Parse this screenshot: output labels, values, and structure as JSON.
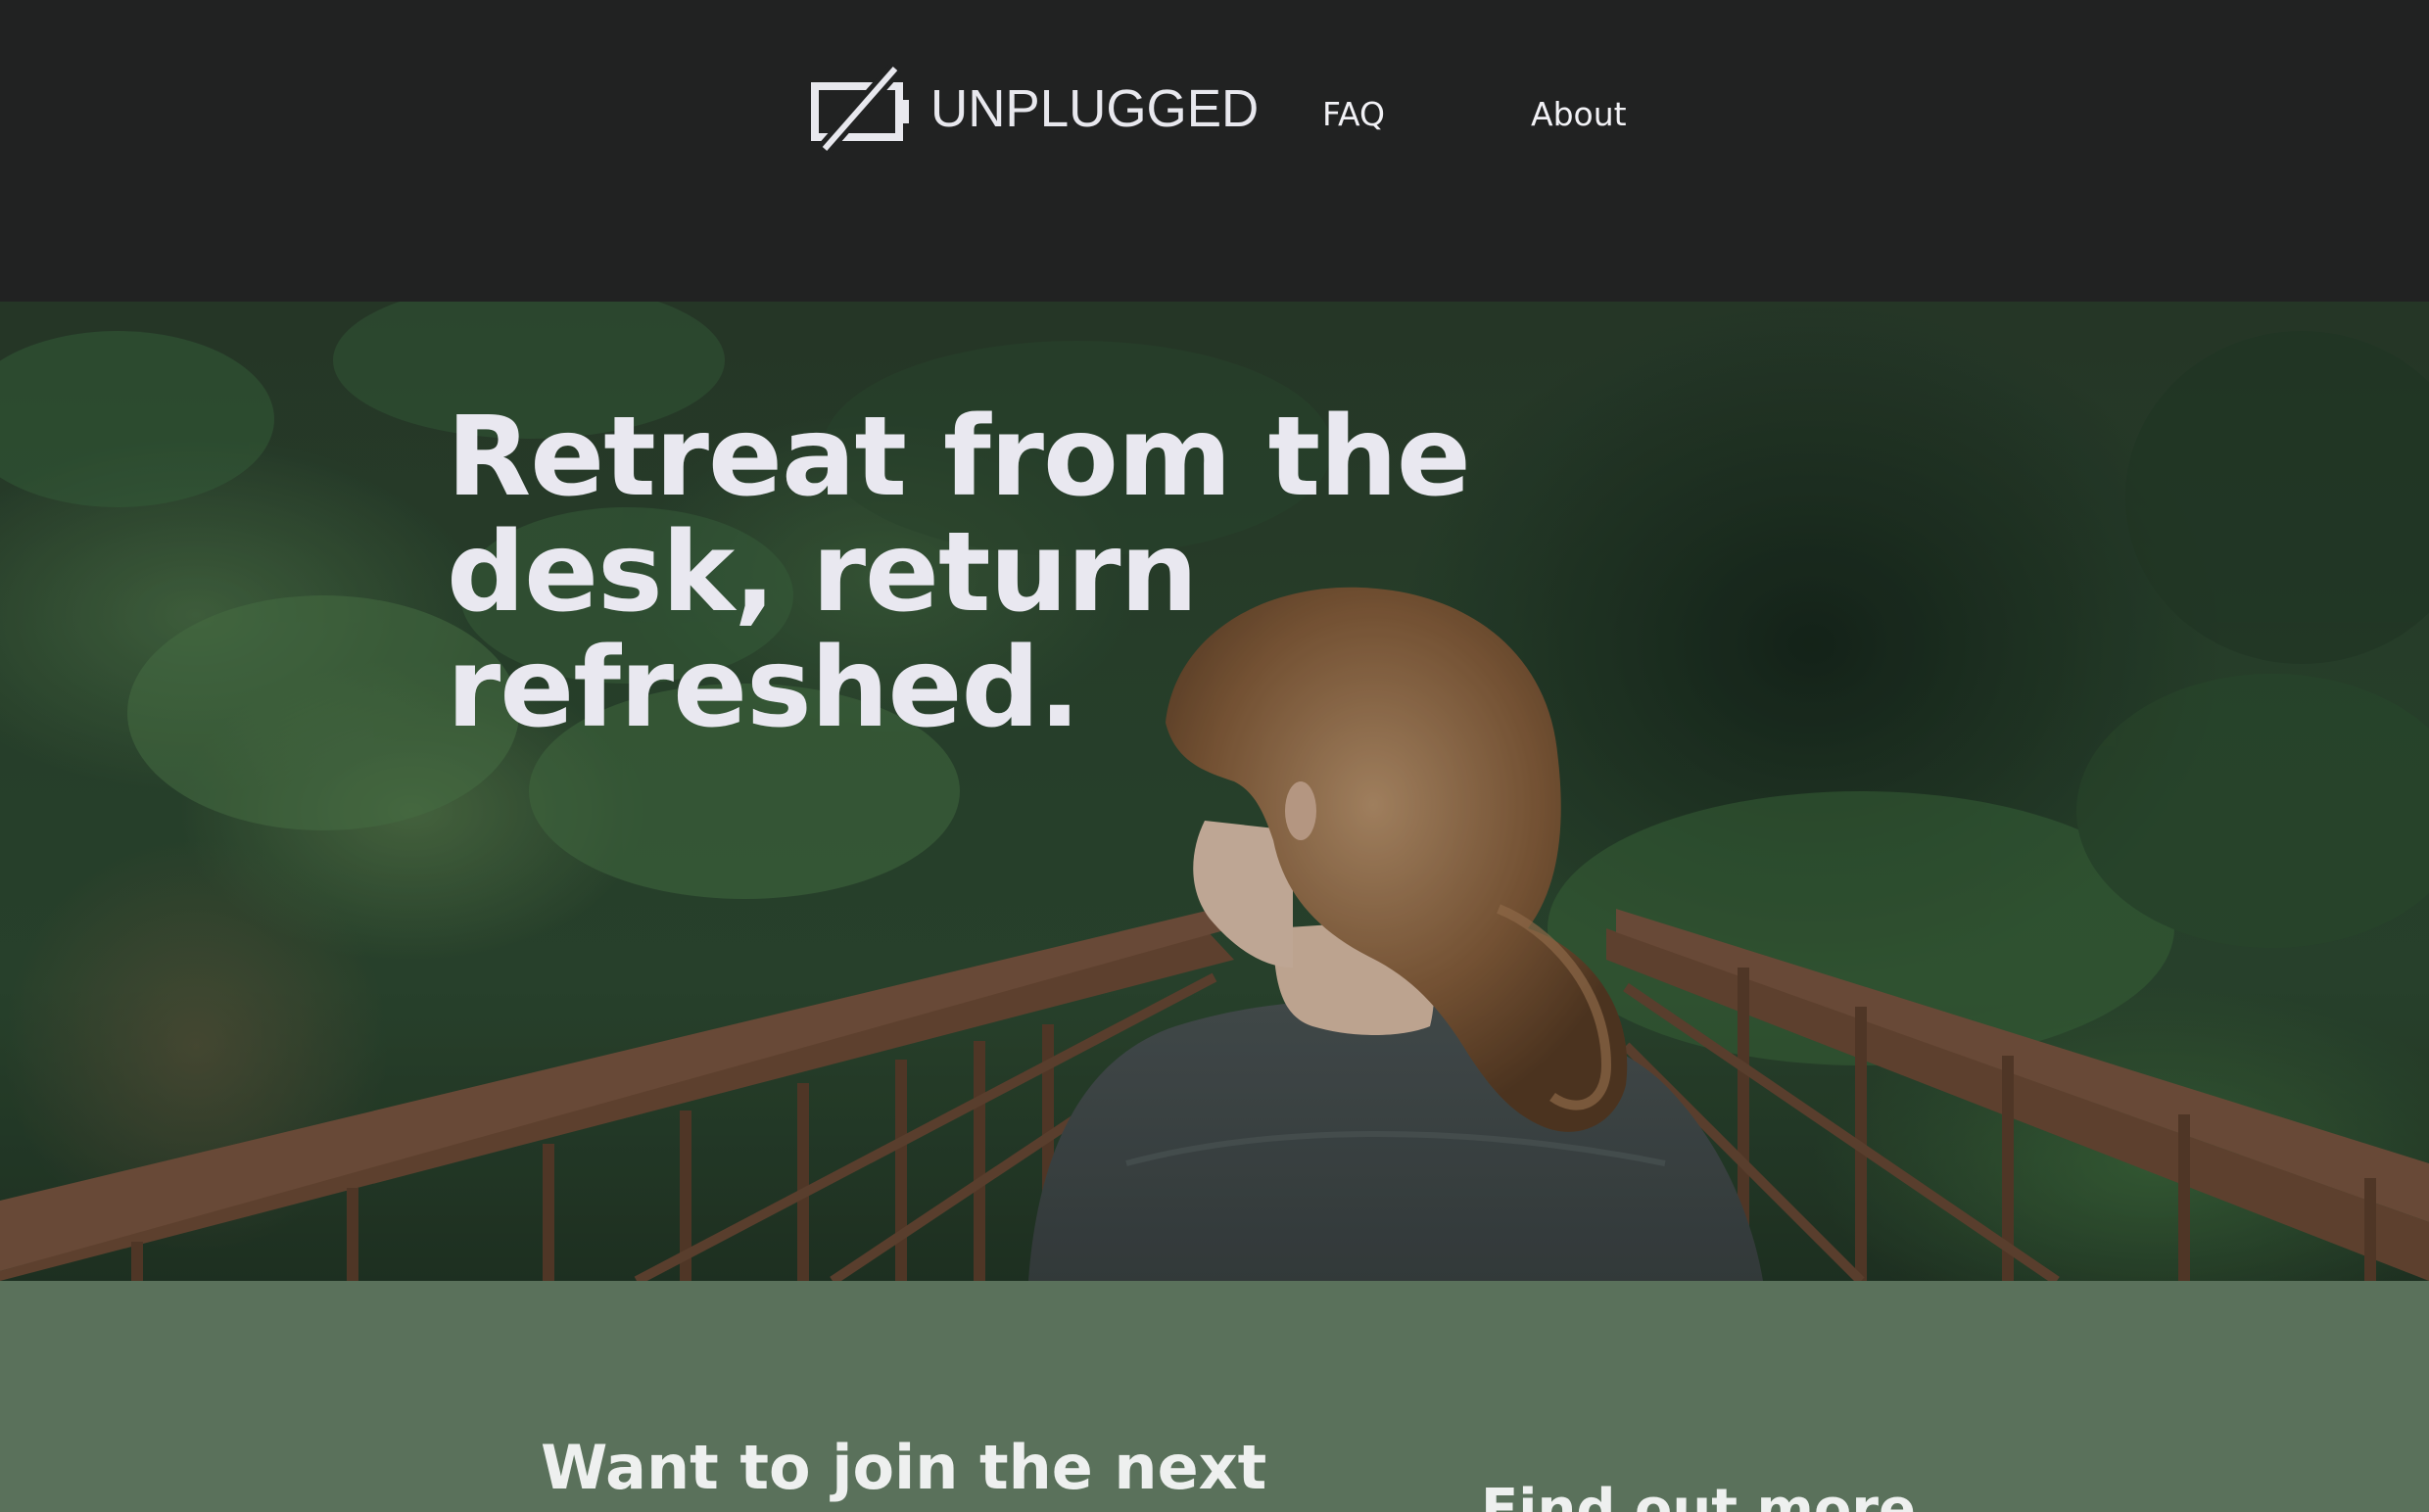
{
  "header": {
    "brand": "UNPLUGGED",
    "logo_icon": "unplugged-battery-icon",
    "nav": {
      "faq": "FAQ",
      "about": "About"
    }
  },
  "hero": {
    "title": "Retreat from the desk, return refreshed."
  },
  "cta": {
    "join_heading": "Want to join the next",
    "more_heading": "Find out more"
  },
  "colors": {
    "header_bg": "#212222",
    "band_bg": "#5a715b",
    "text_light": "#e9e8f0"
  }
}
